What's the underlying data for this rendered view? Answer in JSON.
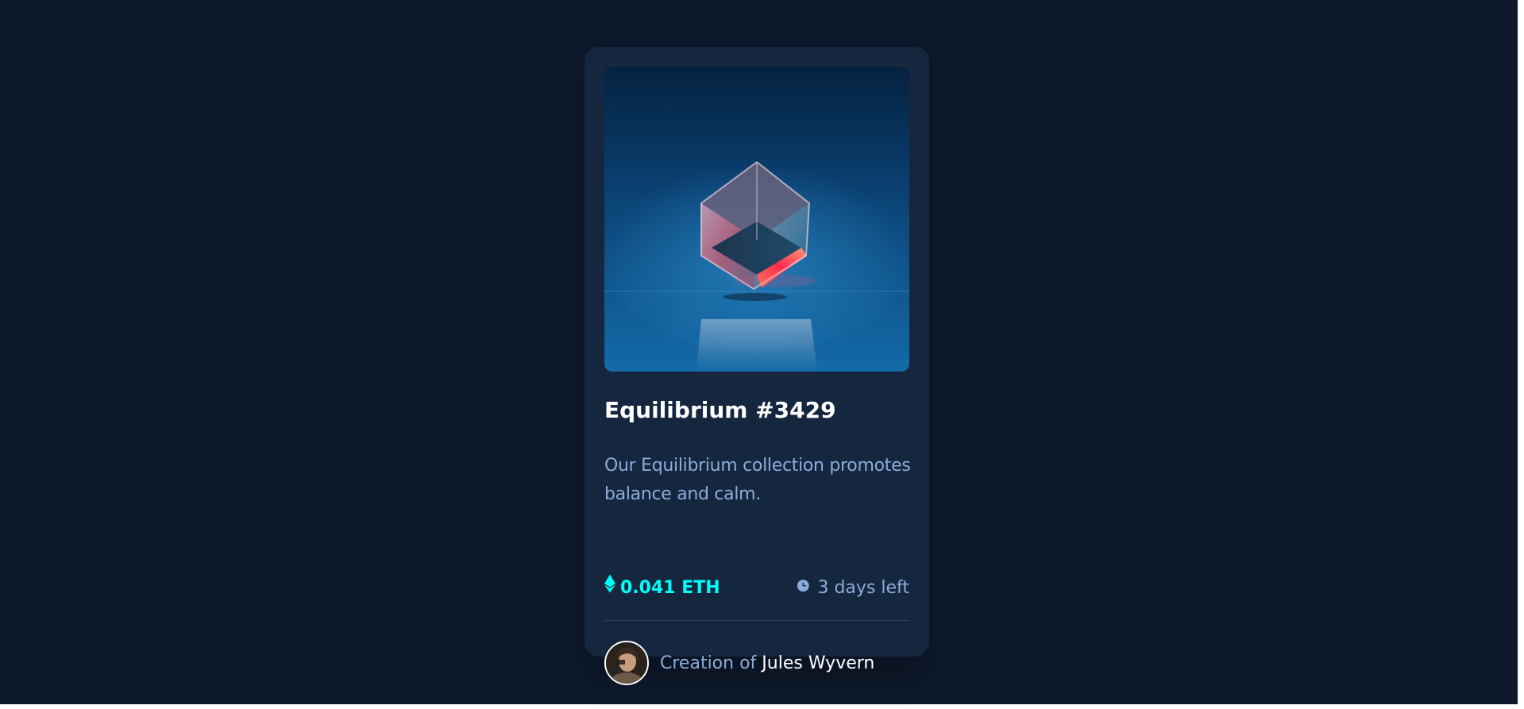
{
  "card": {
    "title": "Equilibrium #3429",
    "description": "Our Equilibrium collection promotes balance and calm.",
    "price": "0.041 ETH",
    "time_left": "3 days left",
    "creator_prefix": "Creation of",
    "creator_name": "Jules Wyvern",
    "image_alt": "Equilibrium cube artwork"
  },
  "icons": {
    "price": "ethereum-icon",
    "time": "clock-icon"
  },
  "colors": {
    "page_background": "#0d192b",
    "card_background": "#15263f",
    "accent_cyan": "#00fff8",
    "soft_blue": "#8bacd9",
    "divider": "#2e405a",
    "white": "#ffffff"
  }
}
